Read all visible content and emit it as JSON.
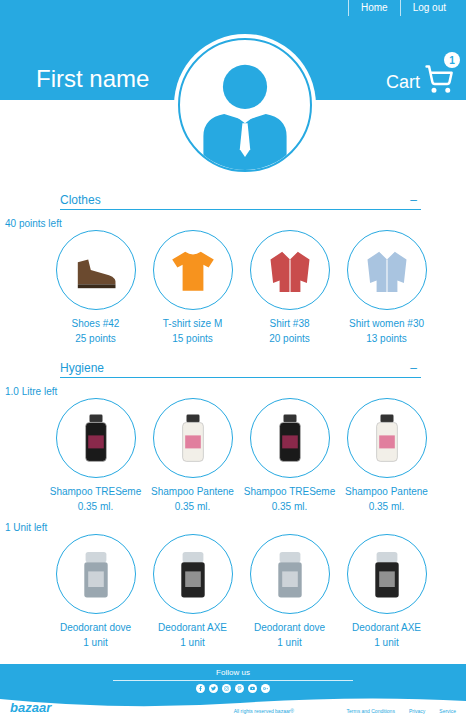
{
  "nav": [
    {
      "label": "Home"
    },
    {
      "label": "Log out"
    }
  ],
  "user": {
    "name": "First name"
  },
  "cart": {
    "label": "Cart",
    "count": "1"
  },
  "sections": [
    {
      "title": "Clothes",
      "toggle": "–",
      "groups": [
        {
          "remaining": "40 points left",
          "items": [
            {
              "name": "Shoes #42",
              "amount": "25 points",
              "kind": "shoe",
              "color": "#6b4a2f"
            },
            {
              "name": "T-shirt size M",
              "amount": "15 points",
              "kind": "tshirt",
              "color": "#f7931e"
            },
            {
              "name": "Shirt #38",
              "amount": "20 points",
              "kind": "shirt",
              "color": "#c94c4c"
            },
            {
              "name": "Shirt women #30",
              "amount": "13 points",
              "kind": "shirt",
              "color": "#a9c4e0"
            }
          ]
        }
      ]
    },
    {
      "title": "Hygiene",
      "toggle": "–",
      "groups": [
        {
          "remaining": "1.0 Litre left",
          "items": [
            {
              "name": "Shampoo TRESeme",
              "amount": "0.35 ml.",
              "kind": "bottle",
              "color": "#1a1a1a"
            },
            {
              "name": "Shampoo Pantene",
              "amount": "0.35 ml.",
              "kind": "bottle",
              "color": "#f2efe8"
            },
            {
              "name": "Shampoo TRESeme",
              "amount": "0.35 ml.",
              "kind": "bottle",
              "color": "#1a1a1a"
            },
            {
              "name": "Shampoo Pantene",
              "amount": "0.35 ml.",
              "kind": "bottle",
              "color": "#f2efe8"
            }
          ]
        },
        {
          "remaining": "1 Unit left",
          "items": [
            {
              "name": "Deodorant dove",
              "amount": "1 unit",
              "kind": "deodorant",
              "color": "#9aa7b0"
            },
            {
              "name": "Deodorant AXE",
              "amount": "1 unit",
              "kind": "deodorant",
              "color": "#232323"
            },
            {
              "name": "Deodorant dove",
              "amount": "1 unit",
              "kind": "deodorant",
              "color": "#9aa7b0"
            },
            {
              "name": "Deodorant AXE",
              "amount": "1 unit",
              "kind": "deodorant",
              "color": "#232323"
            }
          ]
        }
      ]
    }
  ],
  "footer": {
    "follow": "Follow us",
    "logo": "bazaar",
    "copyright": "All rights reserved bazaar®",
    "links": [
      "Terms and Conditions",
      "Privacy",
      "Service"
    ]
  }
}
